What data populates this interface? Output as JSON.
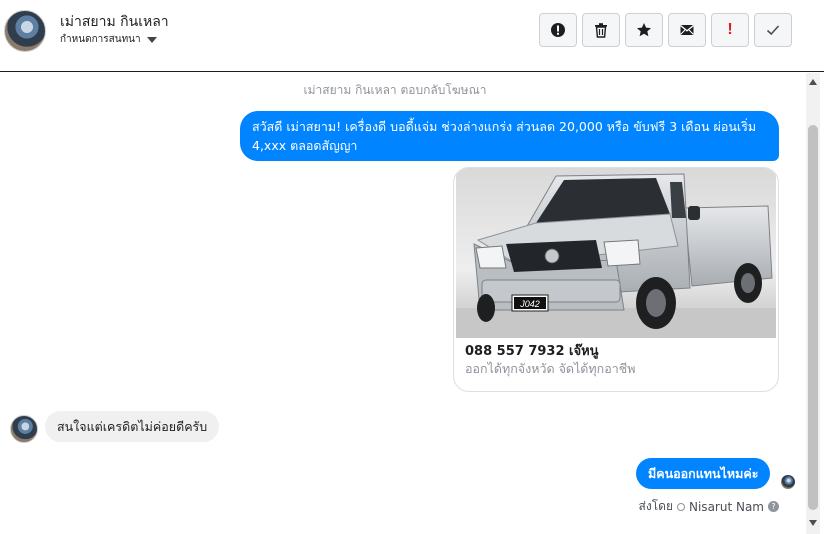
{
  "header": {
    "contact_name": "เม่าสยาม กินเหลา",
    "conversation_settings_label": "กำหนดการสนทนา",
    "toolbar": [
      {
        "name": "report-button",
        "icon": "exclamation-circle-icon"
      },
      {
        "name": "delete-button",
        "icon": "trash-icon"
      },
      {
        "name": "star-button",
        "icon": "star-icon"
      },
      {
        "name": "mark-unread-button",
        "icon": "envelope-icon"
      },
      {
        "name": "spam-button",
        "icon": "exclamation-icon",
        "label": "!"
      },
      {
        "name": "done-button",
        "icon": "check-icon"
      }
    ]
  },
  "messages": {
    "system_note": "เม่าสยาม กินเหลา ตอบกลับโฆษณา",
    "ad_message": "สวัสดี เม่าสยาม! เครื่องดี บอดี้แจ่ม ช่วงล่างแกร่ง ส่วนลด 20,000 หรือ ขับฟรี 3 เดือน ผ่อนเริ่ม 4,xxx ตลอดสัญญา",
    "card": {
      "plate": "J042",
      "title": "088 557 7932 เจ๊หนู",
      "subtitle": "ออกได้ทุกจังหวัด จัดได้ทุกอาชีพ"
    },
    "incoming": "สนใจแต่เครดิตไม่ค่อยดีครับ",
    "outgoing": "มีคนออกแทนไหมค่ะ",
    "sent_by_label": "ส่งโดย",
    "sender_name": "Nisarut Nam"
  },
  "colors": {
    "outgoing_bubble": "#0084ff",
    "incoming_bubble": "#f1f0f0",
    "spam_icon": "#e02020"
  }
}
